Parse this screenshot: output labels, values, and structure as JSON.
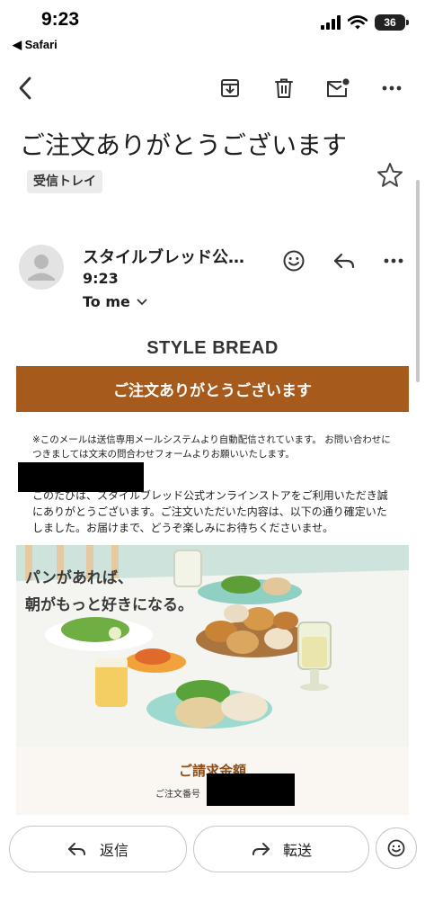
{
  "status_bar": {
    "time": "9:23",
    "back_app": "◀ Safari",
    "battery": "36"
  },
  "email": {
    "subject": "ご注文ありがとうございます",
    "label": "受信トレイ",
    "sender": "スタイルブレッド公…",
    "time": "9:23",
    "recipient": "To me"
  },
  "body": {
    "brand": "STYLE BREAD",
    "banner": "ご注文ありがとうございます",
    "notice": "※このメールは送信専用メールシステムより自動配信されています。 お問い合わせにつきましては文末の問合わせフォームよりお願いいたします。",
    "intro": "このたびは、スタイルブレッド公式オンラインストアをご利用いただき誠にありがとうございます。ご注文いただいた内容は、以下の通り確定いたしました。お届けまで、どうぞ楽しみにお待ちくださいませ。",
    "tagline_1": "パンがあれば、",
    "tagline_2": "朝がもっと好きになる。",
    "invoice_title": "ご請求金額",
    "order_label": "ご注文番号"
  },
  "actions": {
    "reply": "返信",
    "forward": "転送"
  },
  "colors": {
    "banner": "#a65a1c",
    "invoice_title": "#8a4f1a"
  }
}
